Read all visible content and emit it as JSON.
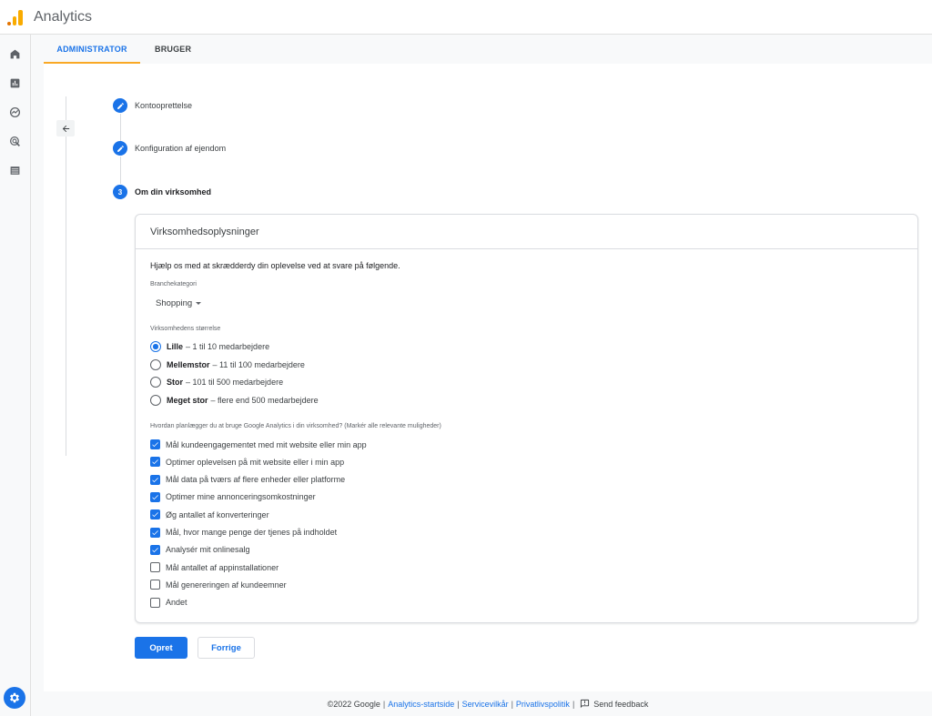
{
  "app": {
    "title": "Analytics"
  },
  "colors": {
    "accent": "#1a73e8",
    "tab_indicator": "#f9a825",
    "logo_dark": "#e37400",
    "logo_light": "#f9ab00"
  },
  "sidenav": {
    "items": [
      {
        "icon": "home-icon",
        "label": "Home"
      },
      {
        "icon": "reports-icon",
        "label": "Reports"
      },
      {
        "icon": "explore-icon",
        "label": "Explore"
      },
      {
        "icon": "advertising-icon",
        "label": "Advertising"
      },
      {
        "icon": "configure-icon",
        "label": "Configure"
      }
    ],
    "settings_icon": "gear-icon"
  },
  "tabs": [
    {
      "label": "ADMINISTRATOR",
      "active": true
    },
    {
      "label": "BRUGER",
      "active": false
    }
  ],
  "stepper": {
    "steps": [
      {
        "label": "Kontooprettelse",
        "state": "done",
        "icon": "edit-icon"
      },
      {
        "label": "Konfiguration af ejendom",
        "state": "done",
        "icon": "edit-icon"
      },
      {
        "label": "Om din virksomhed",
        "state": "current",
        "number": "3"
      }
    ]
  },
  "card": {
    "title": "Virksomhedsoplysninger",
    "intro": "Hjælp os med at skrædderdy din oplevelse ved at svare på følgende.",
    "industry": {
      "label": "Branchekategori",
      "value": "Shopping"
    },
    "size": {
      "label": "Virksomhedens størrelse",
      "options": [
        {
          "name": "Lille",
          "desc": "– 1 til 10 medarbejdere",
          "selected": true
        },
        {
          "name": "Mellemstor",
          "desc": "– 11 til 100 medarbejdere",
          "selected": false
        },
        {
          "name": "Stor",
          "desc": "– 101 til 500 medarbejdere",
          "selected": false
        },
        {
          "name": "Meget stor",
          "desc": "– flere end 500 medarbejdere",
          "selected": false
        }
      ]
    },
    "usage": {
      "label": "Hvordan planlægger du at bruge Google Analytics i din virksomhed? (Markér alle relevante muligheder)",
      "options": [
        {
          "label": "Mål kundeengagementet med mit website eller min app",
          "checked": true
        },
        {
          "label": "Optimer oplevelsen på mit website eller i min app",
          "checked": true
        },
        {
          "label": "Mål data på tværs af flere enheder eller platforme",
          "checked": true
        },
        {
          "label": "Optimer mine annonceringsomkostninger",
          "checked": true
        },
        {
          "label": "Øg antallet af konverteringer",
          "checked": true
        },
        {
          "label": "Mål, hvor mange penge der tjenes på indholdet",
          "checked": true
        },
        {
          "label": "Analysér mit onlinesalg",
          "checked": true
        },
        {
          "label": "Mål antallet af appinstallationer",
          "checked": false
        },
        {
          "label": "Mål genereringen af kundeemner",
          "checked": false
        },
        {
          "label": "Andet",
          "checked": false
        }
      ]
    }
  },
  "buttons": {
    "create": "Opret",
    "previous": "Forrige"
  },
  "footer": {
    "copyright": "©2022 Google",
    "links": [
      "Analytics-startside",
      "Servicevilkår",
      "Privatlivspolitik"
    ],
    "feedback": "Send feedback",
    "separator": "|"
  }
}
